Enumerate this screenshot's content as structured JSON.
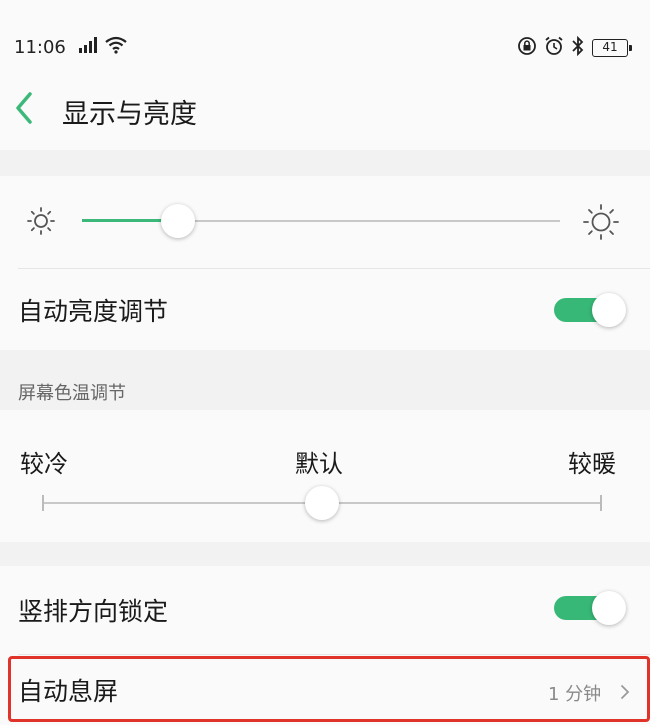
{
  "status_bar": {
    "time": "11:06",
    "battery": "41",
    "left_icons": [
      "signal-icon",
      "wifi-icon"
    ],
    "right_icons": [
      "lock-rotation-icon",
      "alarm-icon",
      "bluetooth-icon",
      "battery-icon"
    ]
  },
  "header": {
    "title": "显示与亮度",
    "back_icon": "chevron-left-icon"
  },
  "brightness": {
    "level": 0.2,
    "auto_brightness_label": "自动亮度调节",
    "auto_brightness_on": true
  },
  "color_temp": {
    "section_label": "屏幕色温调节",
    "cooler_label": "较冷",
    "default_label": "默认",
    "warmer_label": "较暖",
    "level": 0.5
  },
  "orientation_lock": {
    "label": "竖排方向锁定",
    "on": true
  },
  "auto_sleep": {
    "label": "自动息屏",
    "value": "1 分钟"
  },
  "colors": {
    "accent": "#3cb87a",
    "highlight": "#e0342b"
  }
}
